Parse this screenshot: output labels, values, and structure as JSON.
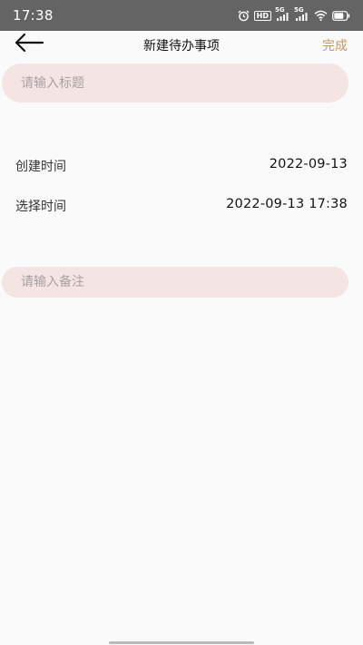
{
  "status_bar": {
    "time": "17:38",
    "icons": [
      "alarm-icon",
      "hd-badge",
      "signal-5g-icon",
      "signal-5g-icon",
      "wifi-icon",
      "battery-icon"
    ],
    "hd_label": "HD",
    "network_label": "5G"
  },
  "header": {
    "back_icon": "arrow-left-icon",
    "title": "新建待办事项",
    "done_label": "完成"
  },
  "form": {
    "title_placeholder": "请输入标题",
    "created_label": "创建时间",
    "created_value": "2022-09-13",
    "select_label": "选择时间",
    "select_value": "2022-09-13 17:38",
    "remark_placeholder": "请输入备注"
  },
  "colors": {
    "accent": "#c8955a",
    "input_bg": "#f5e4e4",
    "status_bar_bg": "#646464",
    "page_bg": "#fafafa"
  }
}
